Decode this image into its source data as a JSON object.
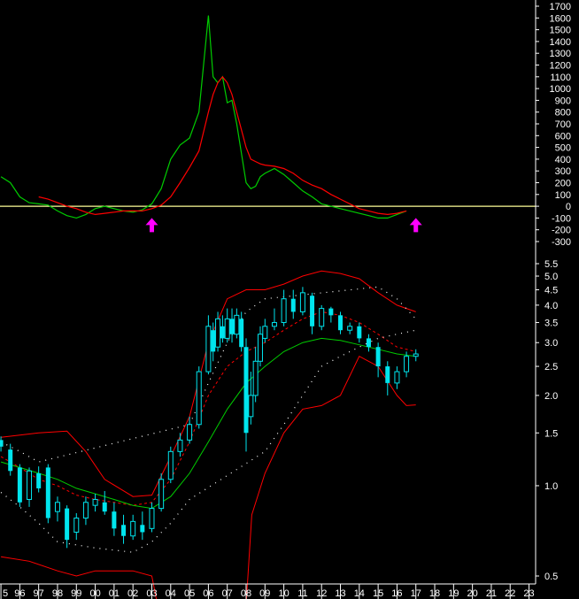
{
  "colors": {
    "background": "#000000",
    "axis": "#ffffff",
    "candle": "#00e5ee",
    "indicator_fast": "#00cc00",
    "indicator_slow": "#ff0000",
    "zero_line": "#ffff99",
    "arrow": "#ff00ff",
    "bollinger": "#ff0000",
    "moving_average": "#00cc00",
    "dots": "#ffffff"
  },
  "chart_data": [
    {
      "type": "line",
      "panel": "indicator",
      "y_ticks": [
        "1700",
        "1600",
        "1500",
        "1400",
        "1300",
        "1200",
        "1100",
        "1000",
        "900",
        "800",
        "700",
        "600",
        "500",
        "400",
        "300",
        "200",
        "100",
        "0",
        "-100",
        "-200",
        "-300"
      ],
      "ylim": [
        -300,
        1700
      ],
      "x": [
        1995.0,
        1995.5,
        1996.0,
        1996.5,
        1997.0,
        1997.5,
        1998.0,
        1998.5,
        1999.0,
        1999.5,
        2000.0,
        2000.5,
        2001.0,
        2001.5,
        2002.0,
        2002.5,
        2003.0,
        2003.5,
        2004.0,
        2004.5,
        2005.0,
        2005.5,
        2006.0,
        2006.25,
        2006.5,
        2006.75,
        2007.0,
        2007.25,
        2007.5,
        2007.75,
        2008.0,
        2008.25,
        2008.5,
        2008.75,
        2009.0,
        2009.5,
        2010.0,
        2010.5,
        2011.0,
        2011.5,
        2012.0,
        2012.5,
        2013.0,
        2013.5,
        2014.0,
        2014.5,
        2015.0,
        2015.5,
        2016.0,
        2016.5,
        2017.0
      ],
      "series": [
        {
          "color": "green",
          "values": [
            250,
            200,
            80,
            30,
            20,
            10,
            -40,
            -80,
            -100,
            -70,
            -20,
            0,
            -20,
            -40,
            -50,
            -30,
            20,
            150,
            400,
            520,
            580,
            800,
            1620,
            1100,
            1050,
            1100,
            880,
            900,
            700,
            450,
            200,
            150,
            170,
            250,
            280,
            320,
            270,
            200,
            130,
            80,
            20,
            0,
            -20,
            -40,
            -60,
            -80,
            -100,
            -100,
            -70,
            -40
          ]
        },
        {
          "color": "red",
          "values": [
            null,
            null,
            null,
            null,
            80,
            60,
            30,
            0,
            -20,
            -50,
            -70,
            -60,
            -50,
            -40,
            -40,
            -40,
            -20,
            10,
            80,
            200,
            330,
            470,
            800,
            950,
            1050,
            1100,
            1050,
            950,
            800,
            650,
            500,
            400,
            380,
            360,
            350,
            340,
            320,
            280,
            220,
            180,
            150,
            100,
            60,
            20,
            -20,
            -40,
            -60,
            -70,
            -60,
            -40
          ]
        }
      ],
      "markers": [
        {
          "x": 2003.0,
          "direction": "up"
        },
        {
          "x": 2017.0,
          "direction": "up"
        }
      ]
    },
    {
      "type": "candlestick",
      "panel": "price",
      "scale": "log",
      "y_ticks": [
        "5.5",
        "5.0",
        "4.5",
        "4.0",
        "3.5",
        "3.0",
        "2.5",
        "2.0",
        "1.5",
        "1.0",
        "0.5"
      ],
      "x_ticks": [
        "5",
        "96",
        "97",
        "98",
        "99",
        "00",
        "01",
        "02",
        "03",
        "04",
        "05",
        "06",
        "07",
        "08",
        "09",
        "10",
        "11",
        "12",
        "13",
        "14",
        "15",
        "16",
        "17",
        "18",
        "19",
        "20",
        "21",
        "22",
        "23"
      ],
      "candles": [
        [
          1995.0,
          1.42,
          1.35,
          1.46,
          1.3
        ],
        [
          1995.5,
          1.32,
          1.12,
          1.38,
          1.08
        ],
        [
          1996.0,
          1.15,
          0.88,
          1.18,
          0.85
        ],
        [
          1996.5,
          0.9,
          1.12,
          1.15,
          0.85
        ],
        [
          1997.0,
          1.1,
          0.98,
          1.16,
          0.95
        ],
        [
          1997.5,
          1.15,
          0.78,
          1.18,
          0.75
        ],
        [
          1998.0,
          0.82,
          0.88,
          0.92,
          0.76
        ],
        [
          1998.5,
          0.84,
          0.66,
          0.86,
          0.62
        ],
        [
          1999.0,
          0.7,
          0.78,
          0.81,
          0.66
        ],
        [
          1999.5,
          0.78,
          0.88,
          0.92,
          0.74
        ],
        [
          2000.0,
          0.86,
          0.9,
          0.94,
          0.82
        ],
        [
          2000.5,
          0.88,
          0.82,
          0.96,
          0.8
        ],
        [
          2001.0,
          0.82,
          0.72,
          0.88,
          0.68
        ],
        [
          2001.5,
          0.74,
          0.68,
          0.8,
          0.64
        ],
        [
          2002.0,
          0.68,
          0.76,
          0.8,
          0.66
        ],
        [
          2002.5,
          0.74,
          0.7,
          0.82,
          0.66
        ],
        [
          2003.0,
          0.72,
          0.84,
          0.88,
          0.7
        ],
        [
          2003.5,
          0.84,
          1.05,
          1.1,
          0.82
        ],
        [
          2004.0,
          1.05,
          1.3,
          1.35,
          1.02
        ],
        [
          2004.5,
          1.3,
          1.42,
          1.5,
          1.25
        ],
        [
          2005.0,
          1.42,
          1.6,
          1.7,
          1.38
        ],
        [
          2005.5,
          1.6,
          2.4,
          2.5,
          1.55
        ],
        [
          2006.0,
          2.4,
          3.4,
          3.7,
          2.35
        ],
        [
          2006.25,
          3.3,
          2.8,
          3.5,
          2.6
        ],
        [
          2006.5,
          2.9,
          3.6,
          3.8,
          2.8
        ],
        [
          2006.75,
          3.4,
          3.1,
          3.7,
          3.0
        ],
        [
          2007.0,
          3.1,
          3.6,
          3.9,
          3.0
        ],
        [
          2007.25,
          3.6,
          3.2,
          3.9,
          3.0
        ],
        [
          2007.5,
          3.2,
          3.7,
          3.9,
          3.1
        ],
        [
          2007.75,
          3.6,
          2.9,
          3.8,
          2.8
        ],
        [
          2008.0,
          2.9,
          1.5,
          3.1,
          1.3
        ],
        [
          2008.25,
          1.7,
          2.0,
          2.4,
          1.6
        ],
        [
          2008.5,
          2.0,
          2.6,
          2.9,
          1.9
        ],
        [
          2008.75,
          2.6,
          3.2,
          3.4,
          2.5
        ],
        [
          2009.0,
          3.1,
          3.4,
          3.6,
          3.0
        ],
        [
          2009.5,
          3.4,
          3.5,
          3.9,
          3.3
        ],
        [
          2010.0,
          3.5,
          4.2,
          4.5,
          3.4
        ],
        [
          2010.5,
          4.2,
          3.8,
          4.5,
          3.6
        ],
        [
          2011.0,
          3.8,
          4.4,
          4.6,
          3.7
        ],
        [
          2011.5,
          4.3,
          3.4,
          4.4,
          3.2
        ],
        [
          2012.0,
          3.4,
          3.9,
          4.0,
          3.3
        ],
        [
          2012.5,
          3.9,
          3.7,
          3.95,
          3.5
        ],
        [
          2013.0,
          3.7,
          3.3,
          3.8,
          3.2
        ],
        [
          2013.5,
          3.3,
          3.4,
          3.5,
          3.2
        ],
        [
          2014.0,
          3.4,
          3.1,
          3.5,
          3.0
        ],
        [
          2014.5,
          3.1,
          2.9,
          3.2,
          2.8
        ],
        [
          2015.0,
          2.9,
          2.5,
          3.0,
          2.3
        ],
        [
          2015.5,
          2.5,
          2.2,
          2.6,
          2.0
        ],
        [
          2016.0,
          2.2,
          2.4,
          2.5,
          2.1
        ],
        [
          2016.5,
          2.4,
          2.7,
          2.8,
          2.3
        ],
        [
          2017.0,
          2.7,
          2.75,
          2.85,
          2.6
        ]
      ],
      "lines": [
        {
          "color": "red",
          "style": "solid",
          "role": "upper band",
          "points": [
            [
              1995.0,
              1.45
            ],
            [
              1997.0,
              1.5
            ],
            [
              1998.5,
              1.52
            ],
            [
              1999.5,
              1.3
            ],
            [
              2000.5,
              1.05
            ],
            [
              2002.0,
              0.92
            ],
            [
              2003.0,
              0.93
            ],
            [
              2004.0,
              1.25
            ],
            [
              2005.0,
              1.7
            ],
            [
              2006.0,
              3.0
            ],
            [
              2007.0,
              4.2
            ],
            [
              2008.0,
              4.5
            ],
            [
              2009.0,
              4.5
            ],
            [
              2010.0,
              4.7
            ],
            [
              2011.0,
              5.0
            ],
            [
              2012.0,
              5.2
            ],
            [
              2013.0,
              5.1
            ],
            [
              2014.0,
              4.9
            ],
            [
              2015.0,
              4.4
            ],
            [
              2016.0,
              4.0
            ],
            [
              2017.0,
              3.8
            ]
          ]
        },
        {
          "color": "red",
          "style": "solid",
          "role": "lower band",
          "points": [
            [
              1995.0,
              0.58
            ],
            [
              1996.5,
              0.56
            ],
            [
              1998.0,
              0.52
            ],
            [
              1999.0,
              0.5
            ],
            [
              2000.0,
              0.52
            ],
            [
              2002.0,
              0.52
            ],
            [
              2003.0,
              0.5
            ],
            [
              2003.3,
              0.4
            ],
            [
              2008.0,
              0.4
            ],
            [
              2008.3,
              0.8
            ],
            [
              2009.0,
              1.1
            ],
            [
              2010.0,
              1.5
            ],
            [
              2011.0,
              1.8
            ],
            [
              2012.0,
              1.85
            ],
            [
              2013.0,
              2.0
            ],
            [
              2014.0,
              2.7
            ],
            [
              2015.0,
              2.5
            ],
            [
              2016.0,
              2.0
            ],
            [
              2016.5,
              1.85
            ],
            [
              2017.0,
              1.86
            ]
          ]
        },
        {
          "color": "red",
          "style": "dashed",
          "role": "middle",
          "points": [
            [
              1995.0,
              1.25
            ],
            [
              1996.0,
              1.15
            ],
            [
              1997.0,
              1.05
            ],
            [
              1998.0,
              1.0
            ],
            [
              1999.0,
              0.93
            ],
            [
              2000.0,
              0.9
            ],
            [
              2001.0,
              0.88
            ],
            [
              2002.0,
              0.86
            ],
            [
              2003.0,
              0.88
            ],
            [
              2004.0,
              1.05
            ],
            [
              2005.0,
              1.4
            ],
            [
              2006.0,
              2.0
            ],
            [
              2007.0,
              2.5
            ],
            [
              2008.0,
              2.8
            ],
            [
              2009.0,
              3.0
            ],
            [
              2010.0,
              3.3
            ],
            [
              2011.0,
              3.6
            ],
            [
              2012.0,
              3.8
            ],
            [
              2013.0,
              3.7
            ],
            [
              2014.0,
              3.5
            ],
            [
              2015.0,
              3.2
            ],
            [
              2016.0,
              2.9
            ],
            [
              2017.0,
              2.8
            ]
          ]
        },
        {
          "color": "green",
          "style": "solid",
          "role": "moving average",
          "points": [
            [
              1995.0,
              1.2
            ],
            [
              1996.0,
              1.15
            ],
            [
              1997.0,
              1.1
            ],
            [
              1998.0,
              1.05
            ],
            [
              1999.0,
              0.98
            ],
            [
              2000.0,
              0.94
            ],
            [
              2001.0,
              0.9
            ],
            [
              2002.0,
              0.86
            ],
            [
              2003.0,
              0.84
            ],
            [
              2004.0,
              0.92
            ],
            [
              2005.0,
              1.1
            ],
            [
              2006.0,
              1.4
            ],
            [
              2007.0,
              1.8
            ],
            [
              2008.0,
              2.2
            ],
            [
              2009.0,
              2.5
            ],
            [
              2010.0,
              2.8
            ],
            [
              2011.0,
              3.0
            ],
            [
              2012.0,
              3.1
            ],
            [
              2013.0,
              3.05
            ],
            [
              2014.0,
              2.95
            ],
            [
              2015.0,
              2.85
            ],
            [
              2016.0,
              2.75
            ],
            [
              2017.0,
              2.7
            ]
          ]
        },
        {
          "color": "white",
          "style": "dotted",
          "role": "upper dots",
          "points": [
            [
              1995.0,
              1.4
            ],
            [
              1996.0,
              1.3
            ],
            [
              1997.0,
              1.2
            ],
            [
              2005.0,
              1.6
            ],
            [
              2006.0,
              2.2
            ],
            [
              2007.0,
              3.0
            ],
            [
              2008.0,
              3.8
            ],
            [
              2009.0,
              4.2
            ],
            [
              2015.0,
              4.6
            ],
            [
              2016.0,
              4.2
            ],
            [
              2017.0,
              3.6
            ]
          ]
        },
        {
          "color": "white",
          "style": "dotted",
          "role": "lower dots",
          "points": [
            [
              1995.0,
              0.95
            ],
            [
              1996.0,
              0.85
            ],
            [
              1997.0,
              0.75
            ],
            [
              1998.0,
              0.65
            ],
            [
              2000.0,
              0.62
            ],
            [
              2002.0,
              0.6
            ],
            [
              2003.0,
              0.65
            ],
            [
              2004.0,
              0.75
            ],
            [
              2005.0,
              0.9
            ],
            [
              2009.0,
              1.3
            ],
            [
              2010.0,
              1.6
            ],
            [
              2011.0,
              2.0
            ],
            [
              2012.0,
              2.5
            ],
            [
              2013.0,
              2.7
            ],
            [
              2014.0,
              2.9
            ],
            [
              2015.0,
              3.1
            ],
            [
              2016.0,
              3.2
            ],
            [
              2017.0,
              3.3
            ]
          ]
        }
      ]
    }
  ]
}
